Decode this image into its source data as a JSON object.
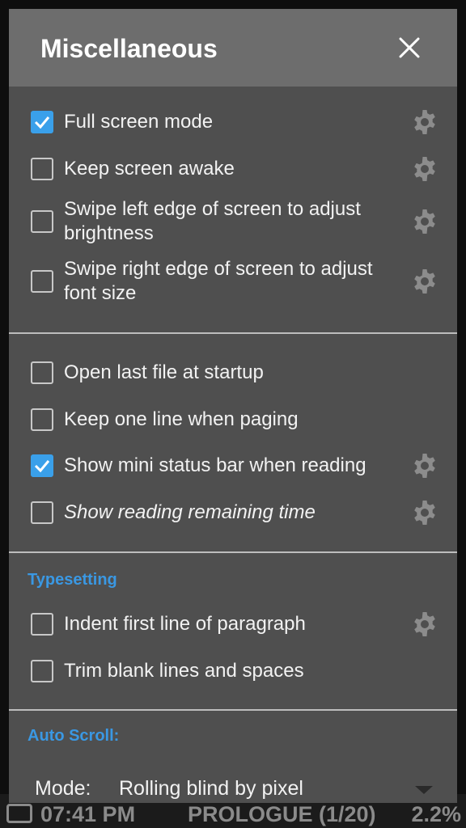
{
  "status_bar": {
    "time": "07:41 PM",
    "chapter": "PROLOGUE (1/20)",
    "percent": "2.2%"
  },
  "dialog": {
    "title": "Miscellaneous",
    "close_icon": "close-icon"
  },
  "items": [
    {
      "label": "Full screen mode",
      "checked": true,
      "gear": true
    },
    {
      "label": "Keep screen awake",
      "checked": false,
      "gear": true
    },
    {
      "label": "Swipe left edge of screen to adjust brightness",
      "checked": false,
      "gear": true
    },
    {
      "label": "Swipe right edge of screen to adjust font size",
      "checked": false,
      "gear": true
    },
    {
      "label": "Open last file at startup",
      "checked": false,
      "gear": false
    },
    {
      "label": "Keep one line when paging",
      "checked": false,
      "gear": false
    },
    {
      "label": "Show mini status bar when reading",
      "checked": true,
      "gear": true
    },
    {
      "label": "Show reading remaining time",
      "checked": false,
      "gear": true
    },
    {
      "label": "Indent first line of paragraph",
      "checked": false,
      "gear": true
    },
    {
      "label": "Trim blank lines and spaces",
      "checked": false,
      "gear": false
    }
  ],
  "sections": {
    "typesetting": "Typesetting",
    "auto_scroll": "Auto Scroll:"
  },
  "auto_scroll": {
    "mode_label": "Mode:",
    "mode_value": "Rolling blind by pixel"
  },
  "colors": {
    "accent": "#3aa0ea",
    "dialog_bg": "#4f4f4f",
    "header_bg": "#6d6d6d"
  }
}
